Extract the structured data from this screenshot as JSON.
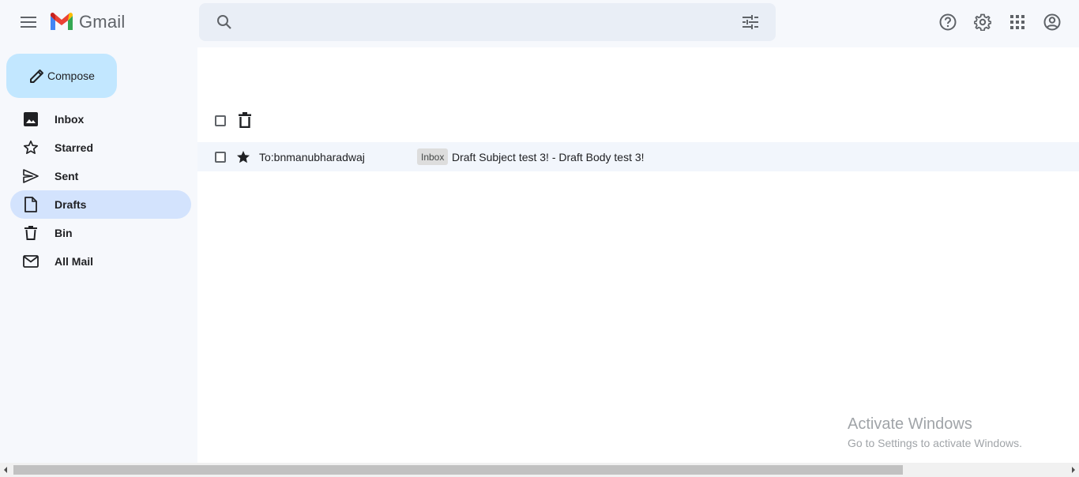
{
  "header": {
    "logo_text": "Gmail",
    "search_placeholder": "",
    "icons": [
      "menu-icon",
      "search-icon",
      "tune-icon",
      "help-icon",
      "settings-icon",
      "apps-icon",
      "account-icon"
    ]
  },
  "compose": {
    "label": "Compose"
  },
  "sidebar": {
    "items": [
      {
        "label": "Inbox",
        "icon": "image-icon",
        "active": false
      },
      {
        "label": "Starred",
        "icon": "star-outline-icon",
        "active": false
      },
      {
        "label": "Sent",
        "icon": "send-icon",
        "active": false
      },
      {
        "label": "Drafts",
        "icon": "draft-icon",
        "active": true
      },
      {
        "label": "Bin",
        "icon": "trash-icon",
        "active": false
      },
      {
        "label": "All Mail",
        "icon": "mail-icon",
        "active": false
      }
    ]
  },
  "mail_list": {
    "rows": [
      {
        "to": "To:bnmanubharadwaj",
        "label_badge": "Inbox",
        "subject": "Draft Subject test 3! - Draft Body test 3!",
        "starred": true
      }
    ]
  },
  "watermark": {
    "title": "Activate Windows",
    "subtitle": "Go to Settings to activate Windows."
  },
  "colors": {
    "background": "#f6f8fc",
    "compose_bg": "#c2e7ff",
    "active_nav_bg": "#d3e3fd",
    "search_bg": "#e9eef6",
    "row_bg": "#f2f6fc"
  }
}
